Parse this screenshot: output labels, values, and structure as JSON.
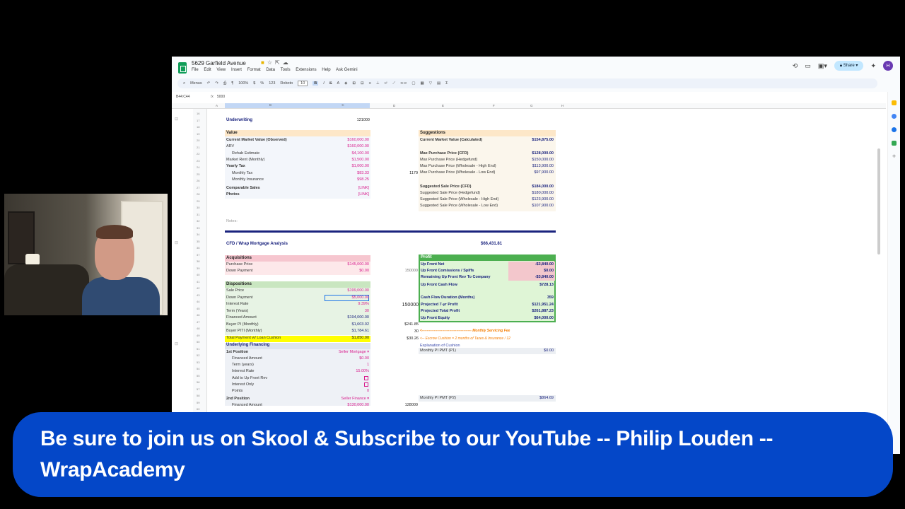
{
  "sheets": {
    "doc_title": "5629 Garfield Avenue",
    "menu": [
      "File",
      "Edit",
      "View",
      "Insert",
      "Format",
      "Data",
      "Tools",
      "Extensions",
      "Help",
      "Ask Gemini"
    ],
    "share_label": "Share",
    "avatar_initial": "H",
    "toolbar": {
      "menus": "Menus",
      "zoom": "100%",
      "font": "Roboto",
      "font_size": "10",
      "bold": "B",
      "fmt": "123",
      "currency": "$",
      "percent": "%"
    },
    "name_box": "B44:C44",
    "fx": "fx",
    "formula_value": "5000",
    "columns": [
      "A",
      "B",
      "C",
      "D",
      "E",
      "F",
      "G",
      "H"
    ],
    "row_numbers": [
      "16",
      "17",
      "18",
      "19",
      "20",
      "21",
      "22",
      "23",
      "24",
      "25",
      "26",
      "27",
      "28",
      "29",
      "30",
      "31",
      "32",
      "33",
      "34",
      "35",
      "36",
      "37",
      "38",
      "39",
      "40",
      "41",
      "42",
      "43",
      "44",
      "45",
      "46",
      "47",
      "48",
      "49",
      "50",
      "51",
      "52",
      "53",
      "54",
      "55",
      "56",
      "57",
      "58",
      "59",
      "60"
    ]
  },
  "underwriting": {
    "title": "Underwriting",
    "value": "121000"
  },
  "value_block": {
    "header": "Value",
    "rows": [
      {
        "label": "Current Market Value (Observed)",
        "value": "$160,000.00"
      },
      {
        "label": "ARV",
        "value": "$160,000.00"
      },
      {
        "label": "Rehab Estimate",
        "value": "$4,100.00"
      },
      {
        "label": "Market Rent (Monthly)",
        "value": "$1,500.00"
      },
      {
        "label": "Yearly Tax",
        "value": "$1,000.00"
      },
      {
        "label": "Monthly Tax",
        "value": "$83.33"
      },
      {
        "label": "Monthly Insurance",
        "value": "$98.25"
      },
      {
        "label": "Comparable Sales",
        "value": "[LINK]"
      },
      {
        "label": "Photos",
        "value": "[LINK]"
      }
    ]
  },
  "suggestions": {
    "header": "Suggestions",
    "rows": [
      {
        "label": "Current Market Value (Calculated)",
        "value": "$154,875.00"
      },
      {
        "label": "Max Purchase Price (CFD)",
        "value": "$128,000.00"
      },
      {
        "label": "Max Purchase Price (Hedgefund)",
        "value": "$150,000.00"
      },
      {
        "label": "Max Purchase Price (Wholesale - High End)",
        "value": "$113,900.00"
      },
      {
        "label": "Max Purchase Price (Wholesale - Low End)",
        "value": "$97,900.00"
      },
      {
        "label": "Suggested Sale Price (CFD)",
        "value": "$184,000.00"
      },
      {
        "label": "Suggested Sale Price (Hedgefund)",
        "value": "$180,000.00"
      },
      {
        "label": "Suggested Sale Price (Wholesale - High End)",
        "value": "$123,900.00"
      },
      {
        "label": "Suggested Sale Price (Wholesale - Low End)",
        "value": "$107,900.00"
      }
    ],
    "side_value": "1179"
  },
  "notes_label": "Notes:",
  "cfd": {
    "title": "CFD / Wrap Mortgage Analysis",
    "total": "$66,431.81"
  },
  "acquisitions": {
    "header": "Acquisitions",
    "rows": [
      {
        "label": "Purchase Price",
        "value": "$145,000.00"
      },
      {
        "label": "Down Payment",
        "value": "$0.00"
      }
    ],
    "side_value": "150000"
  },
  "dispositions": {
    "header": "Dispositions",
    "rows": [
      {
        "label": "Sale Price",
        "value": "$199,000.00"
      },
      {
        "label": "Down Payment",
        "value": "$5,000.00"
      },
      {
        "label": "Interest Rate",
        "value": "9.39%"
      },
      {
        "label": "Term (Years)",
        "value": "30"
      },
      {
        "label": "Financed Amount",
        "value": "$194,000.00"
      },
      {
        "label": "Buyer PI (Monthly)",
        "value": "$1,603.02"
      },
      {
        "label": "Buyer PITI (Monthly)",
        "value": "$1,784.61"
      },
      {
        "label": "Total Payment w/ Loan Cushion",
        "value": "$1,850.00"
      }
    ],
    "side_values": [
      "150000",
      "$241.85",
      "30",
      "$30.26"
    ]
  },
  "profit": {
    "header": "Profit",
    "rows": [
      {
        "label": "Up Front Net",
        "value": "-$3,840.00"
      },
      {
        "label": "Up Front Comissions / Spiffs",
        "value": "$0.00"
      },
      {
        "label": "Remaining Up Front Rev To Company",
        "value": "-$3,840.00"
      },
      {
        "label": "Up Front Cash Flow",
        "value": "$728.13"
      },
      {
        "label": "Cash Flow Duration (Months)",
        "value": "359"
      },
      {
        "label": "Projected 7-yr Profit",
        "value": "$121,951.24"
      },
      {
        "label": "Projected Total Profit",
        "value": "$261,887.23"
      },
      {
        "label": "Up Front Equity",
        "value": "$64,000.00"
      }
    ]
  },
  "annotations": {
    "servicing": "<------------------------------------------ Monthly Servicing Fee",
    "cushion": "<-- Escrow Cushion = 2 months of Taxes & Insurance / 12",
    "explanation": "Explanation of Cushion"
  },
  "underlying": {
    "header": "Underlying Financing",
    "first_position": {
      "label": "1st Position",
      "type": "Seller Mortgage"
    },
    "first_rows": [
      {
        "label": "Financed Amount",
        "value": "$0.00"
      },
      {
        "label": "Term (years)",
        "value": "1"
      },
      {
        "label": "Interest Rate",
        "value": "15.00%"
      },
      {
        "label": "Add to Up Front Rev",
        "value": ""
      },
      {
        "label": "Interest Only",
        "value": ""
      },
      {
        "label": "Points",
        "value": "0"
      }
    ],
    "second_position": {
      "label": "2nd Position",
      "type": "Seller Finance"
    },
    "second_rows": [
      {
        "label": "Financed Amount",
        "value": "$130,000.00"
      }
    ],
    "side_value": "128000",
    "pmt1": {
      "label": "Monthly PI PMT (P1)",
      "value": "$0.00"
    },
    "pmt2": {
      "label": "Monthly PI PMT (P2)",
      "value": "$864.69"
    }
  },
  "banner": {
    "text": "Be sure to join us on Skool & Subscribe to our YouTube -- Philip Louden -- WrapAcademy"
  },
  "colors": {
    "accent": "#0447c8",
    "navy": "#1a237e",
    "pink": "#d81b8c",
    "profit_green": "#4caf50",
    "highlight_yellow": "#ffff00"
  }
}
